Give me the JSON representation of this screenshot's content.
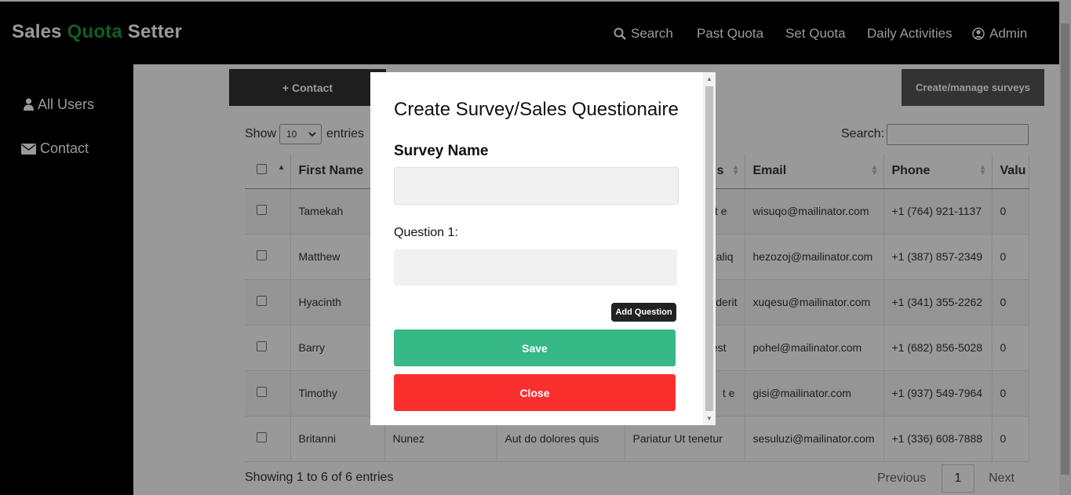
{
  "brand": {
    "part1": "Sales ",
    "part2": "Quota",
    "part3": " Setter"
  },
  "nav": {
    "search": "Search",
    "past_quota": "Past Quota",
    "set_quota": "Set Quota",
    "daily_activities": "Daily Activities",
    "admin": "Admin"
  },
  "sidebar": {
    "items": [
      {
        "label": "All Users",
        "icon": "user-icon"
      },
      {
        "label": "Contact",
        "icon": "envelope-icon"
      }
    ]
  },
  "toolbar": {
    "add_contact": "+ Contact",
    "manage_surveys": "Create/manage surveys"
  },
  "table_controls": {
    "show_label": "Show",
    "page_size": "10",
    "entries_label": "entries",
    "search_label": "Search:",
    "search_value": ""
  },
  "table": {
    "columns": [
      "First Name",
      "s",
      "Email",
      "Phone",
      "Valu"
    ],
    "rows": [
      {
        "first": "Tamekah",
        "last": "",
        "c3": "",
        "c4": "t e",
        "email": "wisuqo@mailinator.com",
        "phone": "+1 (764) 921-1137",
        "value": "0"
      },
      {
        "first": "Matthew",
        "last": "",
        "c3": "",
        "c4": "aliq",
        "email": "hezozoj@mailinator.com",
        "phone": "+1 (387) 857-2349",
        "value": "0"
      },
      {
        "first": "Hyacinth",
        "last": "",
        "c3": "",
        "c4": "derit",
        "email": "xuqesu@mailinator.com",
        "phone": "+1 (341) 355-2262",
        "value": "0"
      },
      {
        "first": "Barry",
        "last": "",
        "c3": "",
        "c4": "est",
        "email": "pohel@mailinator.com",
        "phone": "+1 (682) 856-5028",
        "value": "0"
      },
      {
        "first": "Timothy",
        "last": "",
        "c3": "",
        "c4": "t e",
        "email": "gisi@mailinator.com",
        "phone": "+1 (937) 549-7964",
        "value": "0"
      },
      {
        "first": "Britanni",
        "last": "Nunez",
        "c3": "Aut do dolores quis",
        "c4": "Pariatur Ut tenetur",
        "email": "sesuluzi@mailinator.com",
        "phone": "+1 (336) 608-7888",
        "value": "0"
      }
    ]
  },
  "pagination": {
    "info": "Showing 1 to 6 of 6 entries",
    "previous": "Previous",
    "page": "1",
    "next": "Next"
  },
  "modal": {
    "title": "Create Survey/Sales Questionaire",
    "survey_name_label": "Survey Name",
    "survey_name_value": "",
    "question_label": "Question 1:",
    "question_value": "",
    "add_question": "Add Question",
    "save": "Save",
    "close": "Close"
  },
  "colors": {
    "brand_green": "#1f9d3a",
    "save_green": "#36b887",
    "close_red": "#fc2f2f"
  }
}
